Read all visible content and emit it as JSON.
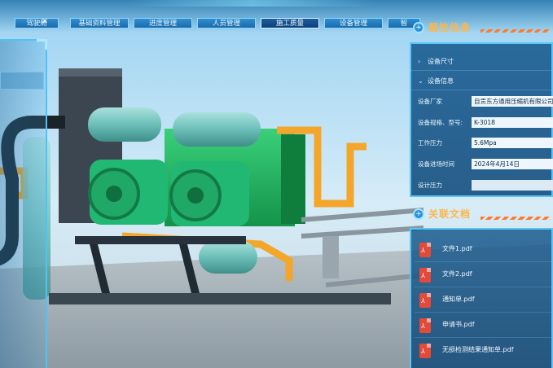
{
  "nav": {
    "tabs": [
      "驾驶舱",
      "基础资料管理",
      "进度管理",
      "人员管理",
      "施工质量",
      "设备管理",
      "智"
    ],
    "active_index": 4,
    "close_glyph": "✕"
  },
  "attributes": {
    "title": "属性信息",
    "icon": "plus-circle-icon",
    "sections": [
      {
        "label": "设备尺寸",
        "expanded": false
      },
      {
        "label": "设备信息",
        "expanded": true
      }
    ],
    "fields": [
      {
        "key": "设备厂家",
        "value": "自贡东方通用压缩机有限公司"
      },
      {
        "key": "设备规格、型号:",
        "value": "K-3018"
      },
      {
        "key": "工作压力",
        "value": "5.6Mpa"
      },
      {
        "key": "设备进场时间",
        "value": "2024年4月14日"
      },
      {
        "key": "设计压力",
        "value": ""
      }
    ]
  },
  "documents": {
    "title": "关联文档",
    "icon": "plus-circle-icon",
    "files": [
      "文件1.pdf",
      "文件2.pdf",
      "通知单.pdf",
      "申请书.pdf",
      "无损检测结果通知单.pdf"
    ]
  },
  "colors": {
    "accent_orange": "#ffb648",
    "panel_blue": "#1b5e92",
    "border_cyan": "#59c6f5",
    "pdf_red": "#e34a3a"
  }
}
